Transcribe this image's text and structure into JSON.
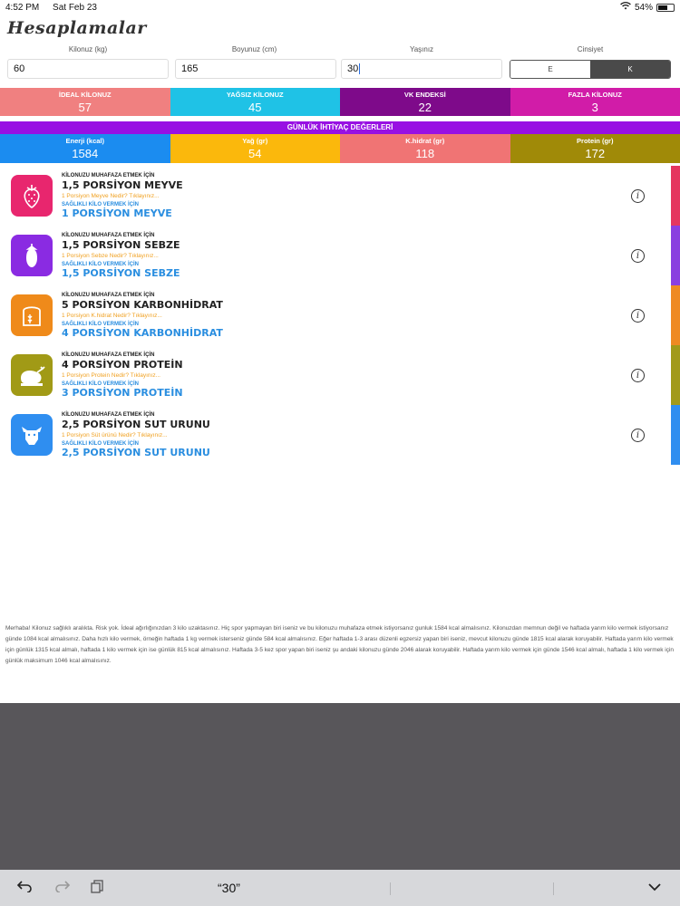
{
  "status": {
    "time": "4:52 PM",
    "date": "Sat Feb 23",
    "battery": "54%",
    "battery_level": 0.54
  },
  "app": {
    "title": "Hesaplamalar"
  },
  "form": {
    "weight": {
      "label": "Kilonuz (kg)",
      "value": "60"
    },
    "height": {
      "label": "Boyunuz (cm)",
      "value": "165"
    },
    "age": {
      "label": "Yaşınız",
      "value": "30"
    },
    "gender": {
      "label": "Cinsiyet",
      "options": [
        "E",
        "K"
      ],
      "selected": "K"
    }
  },
  "stats": [
    {
      "label": "İDEAL KİLONUZ",
      "value": "57",
      "color": "#f08080"
    },
    {
      "label": "YAĞSIZ KİLONUZ",
      "value": "45",
      "color": "#1fc2e6"
    },
    {
      "label": "VK ENDEKSİ",
      "value": "22",
      "color": "#7e0a8a"
    },
    {
      "label": "FAZLA KİLONUZ",
      "value": "3",
      "color": "#d11ca8"
    }
  ],
  "daily": {
    "header": "GÜNLÜK İHTİYAÇ DEĞERLERİ",
    "items": [
      {
        "label": "Enerji (kcal)",
        "value": "1584",
        "color": "#1b8cf0"
      },
      {
        "label": "Yağ (gr)",
        "value": "54",
        "color": "#fbb80c"
      },
      {
        "label": "K.hidrat (gr)",
        "value": "118",
        "color": "#f07474"
      },
      {
        "label": "Protein (gr)",
        "value": "172",
        "color": "#a08a08"
      }
    ]
  },
  "foods": [
    {
      "icon": "strawberry-icon",
      "color": "#e8266e",
      "strip": "#e5365f",
      "keep_label": "KİLONUZU MUHAFAZA ETMEK İÇİN",
      "keep": "1,5 PORSİYON MEYVE",
      "link": "1 Porsiyon Meyve Nedir? Tıklayınız...",
      "lose_label": "SAĞLIKLI KİLO VERMEK İÇİN",
      "lose": "1 PORSİYON MEYVE"
    },
    {
      "icon": "eggplant-icon",
      "color": "#8a2be2",
      "strip": "#8a3fe0",
      "keep_label": "KİLONUZU MUHAFAZA ETMEK İÇİN",
      "keep": "1,5 PORSİYON SEBZE",
      "link": "1 Porsiyon Sebze Nedir? Tıklayınız...",
      "lose_label": "SAĞLIKLI KİLO VERMEK İÇİN",
      "lose": "1,5 PORSİYON SEBZE"
    },
    {
      "icon": "bread-icon",
      "color": "#ef8a1a",
      "strip": "#ef8a22",
      "keep_label": "KİLONUZU MUHAFAZA ETMEK İÇİN",
      "keep": "5 PORSİYON KARBONHİDRAT",
      "link": "1 Porsiyon K.hidrat Nedir? Tıklayınız...",
      "lose_label": "SAĞLIKLI KİLO VERMEK İÇİN",
      "lose": "4 PORSİYON KARBONHİDRAT"
    },
    {
      "icon": "chicken-icon",
      "color": "#a19a16",
      "strip": "#a29a1a",
      "keep_label": "KİLONUZU MUHAFAZA ETMEK İÇİN",
      "keep": "4 PORSİYON PROTEİN",
      "link": "1 Porsiyon Protein Nedir? Tıklayınız...",
      "lose_label": "SAĞLIKLI KİLO VERMEK İÇİN",
      "lose": "3 PORSİYON PROTEİN"
    },
    {
      "icon": "cow-icon",
      "color": "#2f8ef0",
      "strip": "#2f8ef0",
      "keep_label": "KİLONUZU MUHAFAZA ETMEK İÇİN",
      "keep": "2,5 PORSİYON SUT URUNU",
      "link": "1 Porsiyon Süt ürünü Nedir? Tıklayınız...",
      "lose_label": "SAĞLIKLI KİLO VERMEK İÇİN",
      "lose": "2,5 PORSİYON SUT URUNU"
    }
  ],
  "summary": "Merhaba! Kilonuz sağlıklı aralıkta. Risk yok. İdeal ağırlığınızdan 3 kilo uzaktasınız. Hiç spor yapmayan biri iseniz ve bu kilonuzu muhafaza etmek istiyorsanız gunluk 1584 kcal almalısınız. Kilonuzdan memnun değil ve haftada yarım kilo vermek istiyorsanız günde 1084 kcal almalısınız. Daha hızlı kilo vermek, örneğin haftada 1 kg vermek isterseniz günde 584 kcal almalısınız. Eğer haftada 1-3 arası düzenli egzersiz yapan biri iseniz, mevcut kilonuzu günde 1815 kcal alarak koruyabilir. Haftada yarım kilo vermek için günlük 1315 kcal almalı, haftada 1 kilo vermek için ise günlük 815 kcal almalısınız. Haftada 3-5 kez spor yapan biri iseniz şu andaki kilonuzu günde 2046 alarak koruyabilir. Haftada yarım kilo vermek için günde 1546 kcal almalı, haftada 1 kilo vermek için günlük maksimum 1046 kcal almalısınız.",
  "keyboard": {
    "suggestion": "“30”"
  }
}
